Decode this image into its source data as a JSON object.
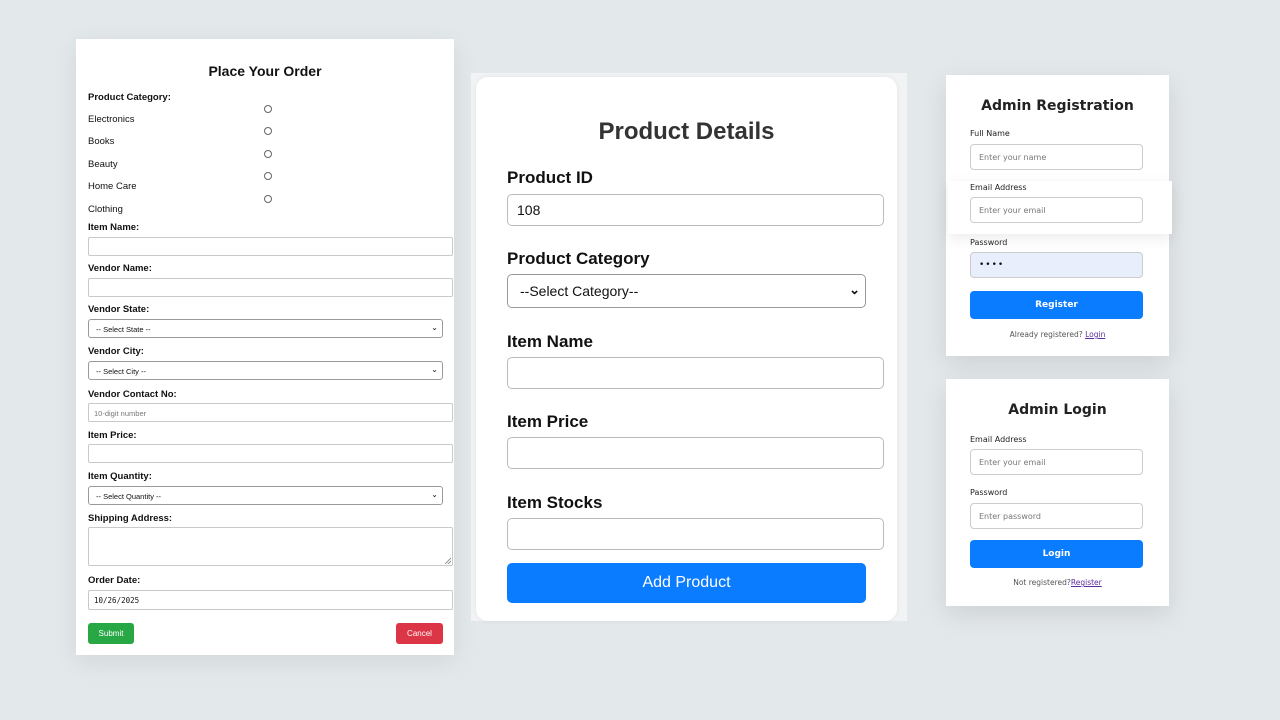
{
  "order_form": {
    "title": "Place Your Order",
    "category_label": "Product Category:",
    "categories": [
      "Electronics",
      "Books",
      "Beauty",
      "Home Care",
      "Clothing"
    ],
    "item_name_label": "Item Name:",
    "vendor_name_label": "Vendor Name:",
    "vendor_state_label": "Vendor State:",
    "vendor_state_value": "-- Select State --",
    "vendor_city_label": "Vendor City:",
    "vendor_city_value": "-- Select City --",
    "vendor_contact_label": "Vendor Contact No:",
    "vendor_contact_placeholder": "10-digit number",
    "item_price_label": "Item Price:",
    "item_quantity_label": "Item Quantity:",
    "item_quantity_value": "-- Select Quantity --",
    "shipping_label": "Shipping Address:",
    "order_date_label": "Order Date:",
    "order_date_value": "10/26/2025",
    "submit_label": "Submit",
    "cancel_label": "Cancel"
  },
  "product_details": {
    "title": "Product Details",
    "product_id_label": "Product ID",
    "product_id_value": "108",
    "category_label": "Product Category",
    "category_value": "--Select Category--",
    "item_name_label": "Item Name",
    "item_price_label": "Item Price",
    "item_stocks_label": "Item Stocks",
    "add_button": "Add Product"
  },
  "admin_registration": {
    "title": "Admin Registration",
    "full_name_label": "Full Name",
    "full_name_placeholder": "Enter your name",
    "email_label": "Email Address",
    "email_placeholder": "Enter your email",
    "password_label": "Password",
    "password_value": "••••",
    "register_button": "Register",
    "footer_text": "Already registered?",
    "footer_link": "Login"
  },
  "admin_login": {
    "title": "Admin Login",
    "email_label": "Email Address",
    "email_placeholder": "Enter your email",
    "password_label": "Password",
    "password_placeholder": "Enter password",
    "login_button": "Login",
    "footer_text": "Not registered?",
    "footer_link": "Register"
  },
  "colors": {
    "primary": "#0a7cff",
    "success": "#28a745",
    "danger": "#dc3545",
    "background": "#e3e8ea"
  }
}
